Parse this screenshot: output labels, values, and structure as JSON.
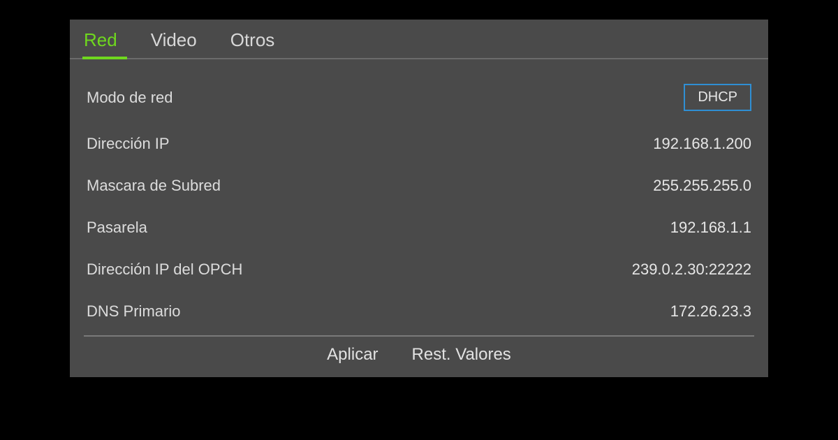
{
  "tabs": {
    "red": "Red",
    "video": "Video",
    "otros": "Otros"
  },
  "network": {
    "mode_label": "Modo  de red",
    "mode_value": "DHCP",
    "ip_label": "Dirección IP",
    "ip_value": "192.168.1.200",
    "mask_label": "Mascara de Subred",
    "mask_value": "255.255.255.0",
    "gateway_label": "Pasarela",
    "gateway_value": "192.168.1.1",
    "opch_label": "Dirección IP del OPCH",
    "opch_value": "239.0.2.30:22222",
    "dns_label": "DNS Primario",
    "dns_value": "172.26.23.3"
  },
  "footer": {
    "apply": "Aplicar",
    "reset": "Rest. Valores"
  }
}
